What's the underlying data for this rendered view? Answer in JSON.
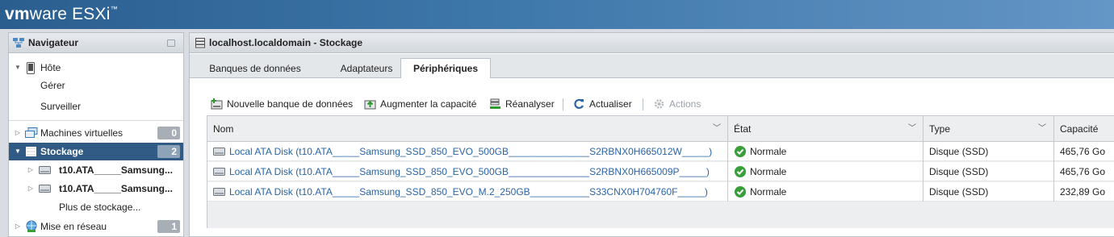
{
  "header": {
    "brand": "vm",
    "brand2": "ware",
    "product": "ESXi",
    "tm": "™"
  },
  "navigator": {
    "title": "Navigateur",
    "host": {
      "label": "Hôte",
      "children": [
        "Gérer",
        "Surveiller"
      ]
    },
    "vms": {
      "label": "Machines virtuelles",
      "count": "0"
    },
    "storage": {
      "label": "Stockage",
      "count": "2",
      "children": [
        "t10.ATA_____Samsung...",
        "t10.ATA_____Samsung..."
      ],
      "more": "Plus de stockage..."
    },
    "network": {
      "label": "Mise en réseau",
      "count": "1"
    }
  },
  "main": {
    "title": "localhost.localdomain - Stockage",
    "tabs": [
      "Banques de données",
      "Adaptateurs",
      "Périphériques"
    ],
    "active_tab": "Périphériques",
    "toolbar": {
      "new_datastore": "Nouvelle banque de données",
      "increase_capacity": "Augmenter la capacité",
      "rescan": "Réanalyser",
      "refresh": "Actualiser",
      "actions": "Actions"
    },
    "columns": [
      "Nom",
      "État",
      "Type",
      "Capacité"
    ],
    "rows": [
      {
        "name": "Local ATA Disk (t10.ATA_____Samsung_SSD_850_EVO_500GB_______________S2RBNX0H665012W_____)",
        "state": "Normale",
        "type": "Disque (SSD)",
        "capacity": "465,76 Go"
      },
      {
        "name": "Local ATA Disk (t10.ATA_____Samsung_SSD_850_EVO_500GB_______________S2RBNX0H665009P_____)",
        "state": "Normale",
        "type": "Disque (SSD)",
        "capacity": "465,76 Go"
      },
      {
        "name": "Local ATA Disk (t10.ATA_____Samsung_SSD_850_EVO_M.2_250GB___________S33CNX0H704760F_____)",
        "state": "Normale",
        "type": "Disque (SSD)",
        "capacity": "232,89 Go"
      }
    ]
  },
  "colors": {
    "accent": "#315a85",
    "link": "#2a64a6",
    "ok": "#3a9e3a"
  }
}
